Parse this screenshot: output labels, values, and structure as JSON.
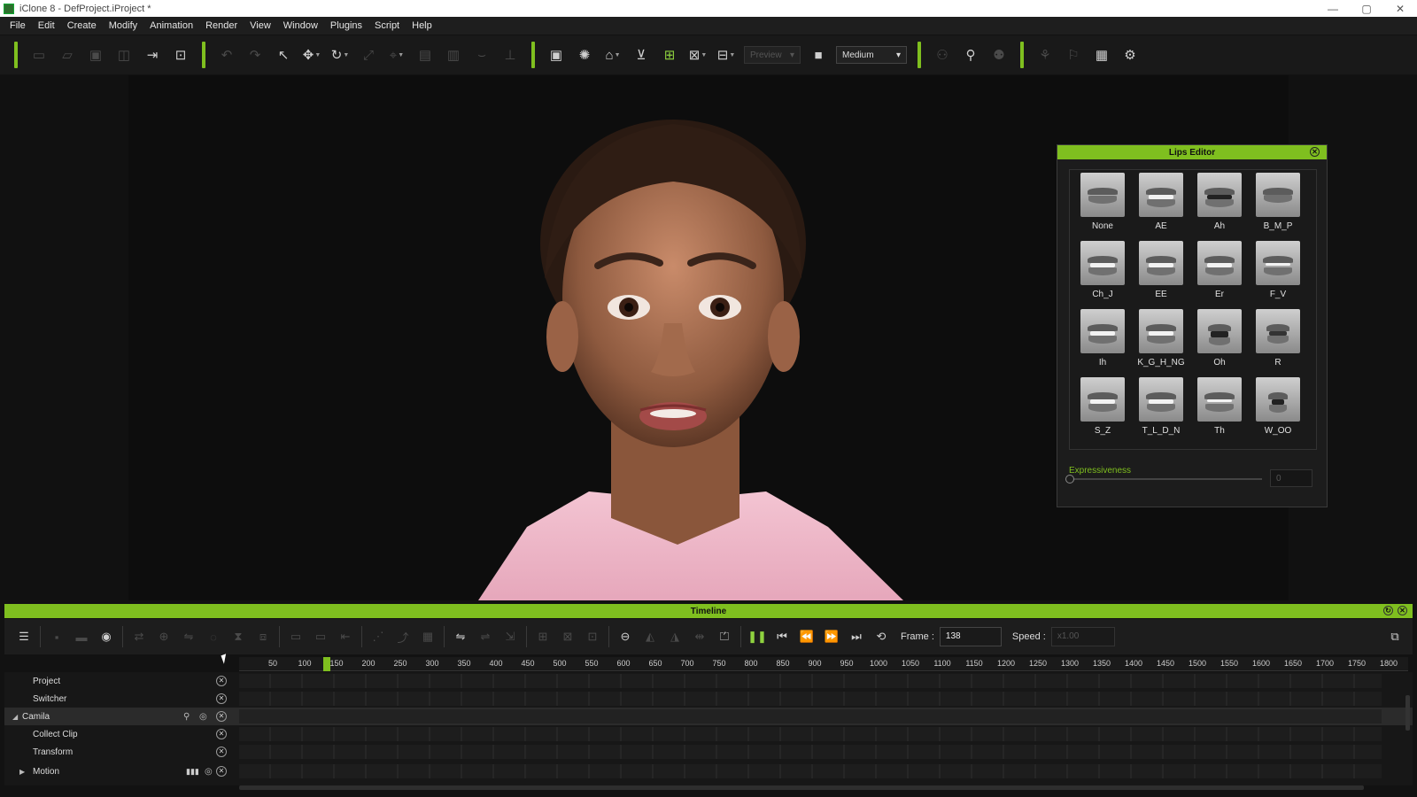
{
  "window": {
    "title": "iClone 8 - DefProject.iProject *",
    "controls": [
      "—",
      "▢",
      "✕"
    ]
  },
  "menu": [
    "File",
    "Edit",
    "Create",
    "Modify",
    "Animation",
    "Render",
    "View",
    "Window",
    "Plugins",
    "Script",
    "Help"
  ],
  "toolbar": {
    "preview_combo": "Preview",
    "quality_combo": "Medium"
  },
  "lips_editor": {
    "title": "Lips Editor",
    "visemes": [
      "None",
      "AE",
      "Ah",
      "B_M_P",
      "Ch_J",
      "EE",
      "Er",
      "F_V",
      "Ih",
      "K_G_H_NG",
      "Oh",
      "R",
      "S_Z",
      "T_L_D_N",
      "Th",
      "W_OO"
    ],
    "expressiveness_label": "Expressiveness",
    "expressiveness_value": "0"
  },
  "timeline": {
    "title": "Timeline",
    "frame_label": "Frame :",
    "frame_value": "138",
    "speed_label": "Speed :",
    "speed_value": "x1.00",
    "ruler_ticks": [
      "50",
      "100",
      "150",
      "200",
      "250",
      "300",
      "350",
      "400",
      "450",
      "500",
      "550",
      "600",
      "650",
      "700",
      "750",
      "800",
      "850",
      "900",
      "950",
      "1000",
      "1050",
      "1100",
      "1150",
      "1200",
      "1250",
      "1300",
      "1350",
      "1400",
      "1450",
      "1500",
      "1550",
      "1600",
      "1650",
      "1700",
      "1750",
      "1800"
    ],
    "tracks": [
      {
        "name": "Project"
      },
      {
        "name": "Switcher"
      },
      {
        "name": "Camila"
      },
      {
        "name": "Collect Clip"
      },
      {
        "name": "Transform"
      },
      {
        "name": "Motion"
      }
    ]
  },
  "colors": {
    "accent": "#7fbf1f"
  }
}
